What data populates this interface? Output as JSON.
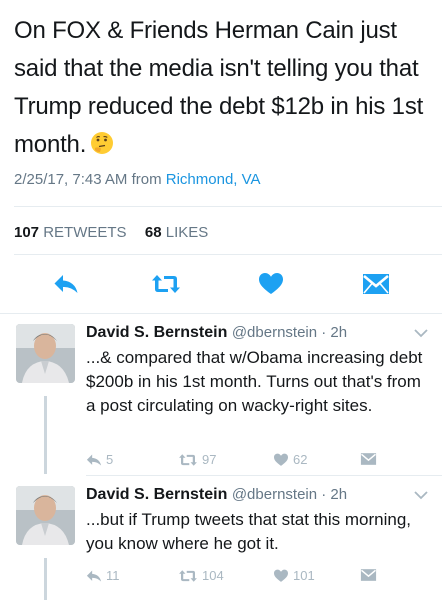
{
  "main_tweet": {
    "text": "On FOX & Friends Herman Cain just said that the media isn't telling you that Trump reduced the debt $12b in his 1st month.",
    "emoji_icon": "thinking-face-icon",
    "timestamp": "2/25/17, 7:43 AM from",
    "location": "Richmond, VA",
    "retweet_count": "107",
    "retweet_label": "RETWEETS",
    "like_count": "68",
    "like_label": "LIKES"
  },
  "actions": [
    "reply-icon",
    "retweet-icon",
    "like-icon",
    "dm-icon"
  ],
  "replies": [
    {
      "name": "David S. Bernstein",
      "handle": "@dbernstein · 2h",
      "text": "...& compared that w/Obama increasing debt $200b in his 1st month. Turns out that's from a post circulating on wacky-right sites.",
      "reply_count": "5",
      "retweet_count": "97",
      "like_count": "62"
    },
    {
      "name": "David S. Bernstein",
      "handle": "@dbernstein · 2h",
      "text": "...but if Trump tweets that stat this morning, you know where he got it.",
      "reply_count": "11",
      "retweet_count": "104",
      "like_count": "101"
    }
  ],
  "colors": {
    "link": "#1b95e0",
    "muted": "#657786",
    "icon": "#aab8c2",
    "action_icon": "#1da1f2",
    "divider": "#e6ecf0"
  }
}
